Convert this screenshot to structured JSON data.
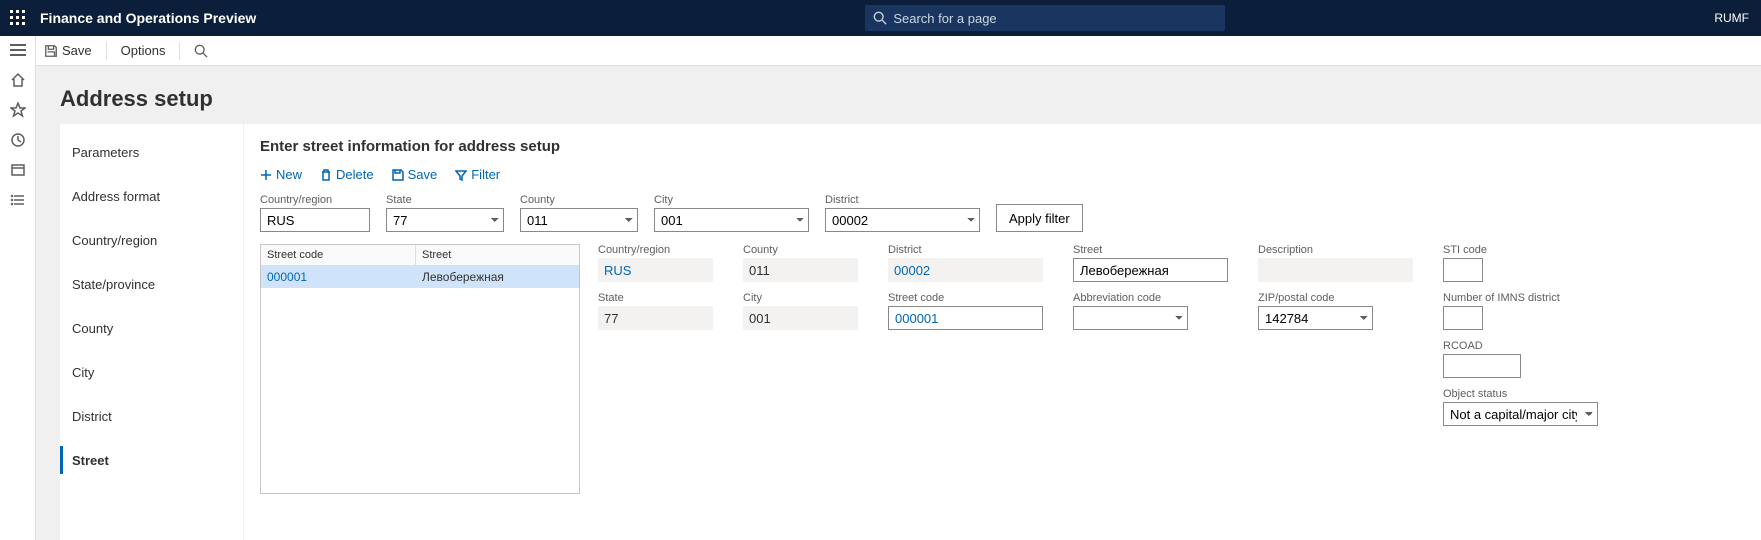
{
  "topbar": {
    "title": "Finance and Operations Preview",
    "search_placeholder": "Search for a page",
    "user": "RUMF"
  },
  "cmdbar": {
    "save": "Save",
    "options": "Options"
  },
  "page": {
    "title": "Address setup"
  },
  "sidenav": [
    {
      "label": "Parameters",
      "active": false
    },
    {
      "label": "Address format",
      "active": false
    },
    {
      "label": "Country/region",
      "active": false
    },
    {
      "label": "State/province",
      "active": false
    },
    {
      "label": "County",
      "active": false
    },
    {
      "label": "City",
      "active": false
    },
    {
      "label": "District",
      "active": false
    },
    {
      "label": "Street",
      "active": true
    }
  ],
  "form": {
    "title": "Enter street information for address setup",
    "actions": {
      "new": "New",
      "delete": "Delete",
      "save": "Save",
      "filter": "Filter"
    },
    "filter_fields": {
      "country_region_label": "Country/region",
      "country_region_value": "RUS",
      "state_label": "State",
      "state_value": "77",
      "county_label": "County",
      "county_value": "011",
      "city_label": "City",
      "city_value": "001",
      "district_label": "District",
      "district_value": "00002",
      "apply_filter": "Apply filter"
    },
    "grid": {
      "col1": "Street code",
      "col2": "Street",
      "rows": [
        {
          "code": "000001",
          "street": "Левобережная"
        }
      ]
    },
    "detail": {
      "country_region_label": "Country/region",
      "country_region_value": "RUS",
      "state_label": "State",
      "state_value": "77",
      "county_label": "County",
      "county_value": "011",
      "city_label": "City",
      "city_value": "001",
      "district_label": "District",
      "district_value": "00002",
      "street_code_label": "Street code",
      "street_code_value": "000001",
      "street_label": "Street",
      "street_value": "Левобережная",
      "abbrev_label": "Abbreviation code",
      "abbrev_value": "",
      "description_label": "Description",
      "description_value": "",
      "zip_label": "ZIP/postal code",
      "zip_value": "142784",
      "sti_label": "STI code",
      "sti_value": "",
      "imns_label": "Number of IMNS district",
      "imns_value": "",
      "rcoad_label": "RCOAD",
      "rcoad_value": "",
      "object_status_label": "Object status",
      "object_status_value": "Not a capital/major city"
    }
  }
}
